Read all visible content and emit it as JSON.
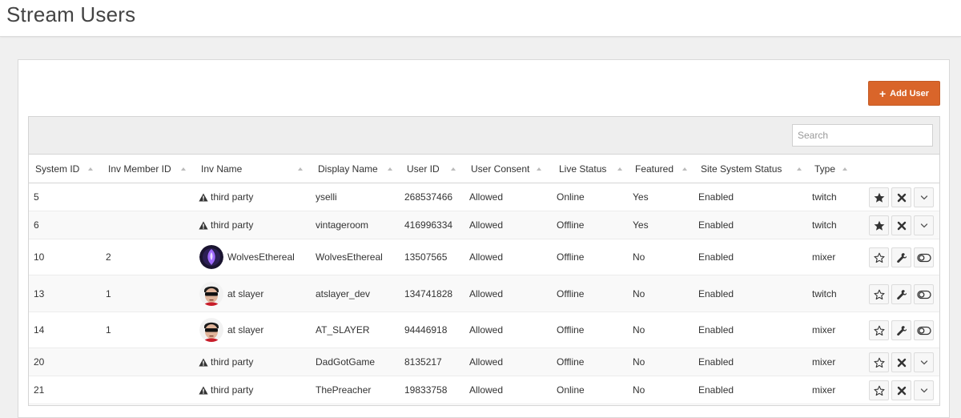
{
  "page": {
    "title": "Stream Users"
  },
  "toolbar": {
    "add_user_label": "Add User"
  },
  "search": {
    "placeholder": "Search",
    "value": ""
  },
  "columns": [
    "System ID",
    "Inv Member ID",
    "Inv Name",
    "Display Name",
    "User ID",
    "User Consent",
    "Live Status",
    "Featured",
    "Site System Status",
    "Type"
  ],
  "rows": [
    {
      "system_id": "5",
      "inv_member_id": "",
      "inv_name": "third party",
      "avatar": "warning",
      "display_name": "yselli",
      "user_id": "268537466",
      "consent": "Allowed",
      "live_status": "Online",
      "featured": "Yes",
      "site_status": "Enabled",
      "type": "twitch",
      "actions": [
        "star-filled",
        "close",
        "chevron-down"
      ]
    },
    {
      "system_id": "6",
      "inv_member_id": "",
      "inv_name": "third party",
      "avatar": "warning",
      "display_name": "vintageroom",
      "user_id": "416996334",
      "consent": "Allowed",
      "live_status": "Offline",
      "featured": "Yes",
      "site_status": "Enabled",
      "type": "twitch",
      "actions": [
        "star-filled",
        "close",
        "chevron-down"
      ]
    },
    {
      "system_id": "10",
      "inv_member_id": "2",
      "inv_name": "WolvesEthereal",
      "avatar": "wolves",
      "display_name": "WolvesEthereal",
      "user_id": "13507565",
      "consent": "Allowed",
      "live_status": "Offline",
      "featured": "No",
      "site_status": "Enabled",
      "type": "mixer",
      "actions": [
        "star-outline",
        "wrench",
        "toggle"
      ]
    },
    {
      "system_id": "13",
      "inv_member_id": "1",
      "inv_name": "at slayer",
      "avatar": "slayer",
      "display_name": "atslayer_dev",
      "user_id": "134741828",
      "consent": "Allowed",
      "live_status": "Offline",
      "featured": "No",
      "site_status": "Enabled",
      "type": "twitch",
      "actions": [
        "star-outline",
        "wrench",
        "toggle"
      ]
    },
    {
      "system_id": "14",
      "inv_member_id": "1",
      "inv_name": "at slayer",
      "avatar": "slayer",
      "display_name": "AT_SLAYER",
      "user_id": "94446918",
      "consent": "Allowed",
      "live_status": "Offline",
      "featured": "No",
      "site_status": "Enabled",
      "type": "mixer",
      "actions": [
        "star-outline",
        "wrench",
        "toggle"
      ]
    },
    {
      "system_id": "20",
      "inv_member_id": "",
      "inv_name": "third party",
      "avatar": "warning",
      "display_name": "DadGotGame",
      "user_id": "8135217",
      "consent": "Allowed",
      "live_status": "Offline",
      "featured": "No",
      "site_status": "Enabled",
      "type": "mixer",
      "actions": [
        "star-outline",
        "close",
        "chevron-down"
      ]
    },
    {
      "system_id": "21",
      "inv_member_id": "",
      "inv_name": "third party",
      "avatar": "warning",
      "display_name": "ThePreacher",
      "user_id": "19833758",
      "consent": "Allowed",
      "live_status": "Online",
      "featured": "No",
      "site_status": "Enabled",
      "type": "mixer",
      "actions": [
        "star-outline",
        "close",
        "chevron-down"
      ]
    }
  ],
  "colors": {
    "accent": "#d9652a",
    "grid_header": "#eeeeee"
  }
}
